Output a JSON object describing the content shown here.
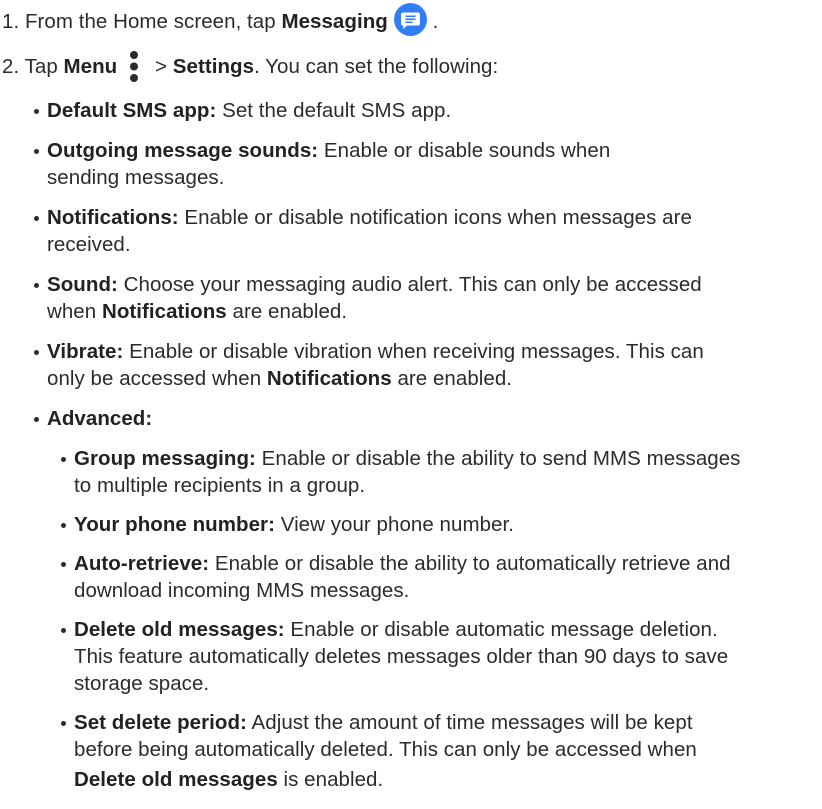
{
  "steps": {
    "one": {
      "prefix": "1. From the Home screen, tap ",
      "bold": "Messaging",
      "suffix": " .",
      "icon": "messaging-app-icon"
    },
    "two": {
      "prefix": "2. Tap ",
      "bold_menu": "Menu",
      "sep": " > ",
      "bold_settings": "Settings",
      "suffix": ". You can set the following:",
      "icon": "more-vertical-icon"
    }
  },
  "settings": [
    {
      "label": "Default SMS app:",
      "text": " Set the default SMS app."
    },
    {
      "label": "Outgoing message sounds:",
      "text": " Enable or disable sounds when",
      "text2": "sending messages."
    },
    {
      "label": "Notifications:",
      "text": " Enable or disable notification icons when messages are",
      "text2": "received."
    },
    {
      "label": "Sound:",
      "text": " Choose your messaging audio alert. This can only be accessed",
      "text2a": "when ",
      "bold2": "Notifications",
      "text2b": " are enabled."
    },
    {
      "label": "Vibrate:",
      "text": " Enable or disable vibration when receiving messages. This can",
      "text2a": "only be accessed when ",
      "bold2": "Notifications",
      "text2b": " are enabled."
    },
    {
      "label": "Advanced:"
    }
  ],
  "advanced": [
    {
      "label": "Group messaging:",
      "text": " Enable or disable the ability to send MMS messages",
      "text2": "to multiple recipients in a group."
    },
    {
      "label": "Your phone number:",
      "text": " View your phone number."
    },
    {
      "label": "Auto-retrieve:",
      "text": " Enable or disable the ability to automatically retrieve and",
      "text2": "download incoming MMS messages."
    },
    {
      "label": "Delete old messages:",
      "text": " Enable or disable automatic message deletion.",
      "text2": "This feature automatically deletes messages older than 90 days to save",
      "text3": "storage space."
    },
    {
      "label": "Set delete period:",
      "text": " Adjust the amount of time messages will be kept",
      "text2": "before being automatically deleted. This can only be accessed when",
      "bold3": "Delete old messages",
      "text3": " is enabled."
    }
  ],
  "colors": {
    "text": "#2b2b2b",
    "icon_blue": "#2f7ef6",
    "icon_white": "#ffffff"
  }
}
